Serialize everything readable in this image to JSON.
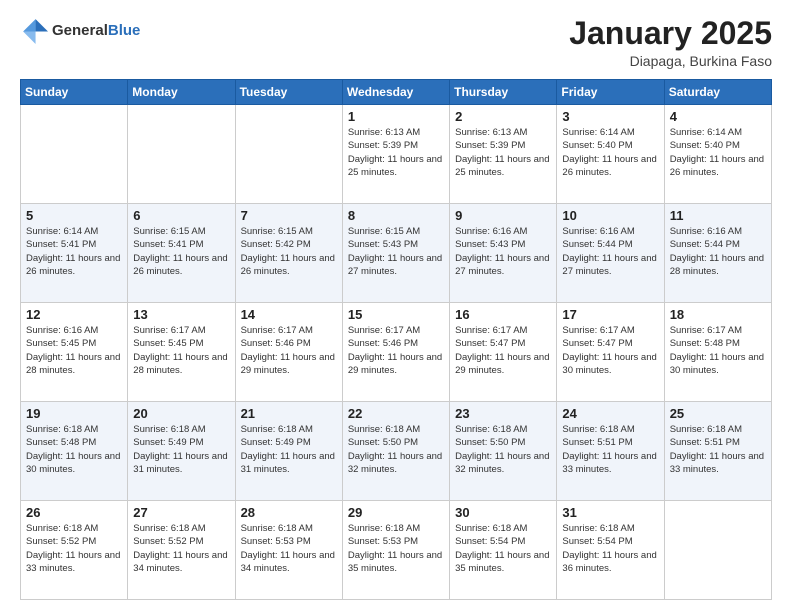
{
  "header": {
    "logo_general": "General",
    "logo_blue": "Blue",
    "month_title": "January 2025",
    "location": "Diapaga, Burkina Faso"
  },
  "weekdays": [
    "Sunday",
    "Monday",
    "Tuesday",
    "Wednesday",
    "Thursday",
    "Friday",
    "Saturday"
  ],
  "weeks": [
    [
      {
        "day": "",
        "info": ""
      },
      {
        "day": "",
        "info": ""
      },
      {
        "day": "",
        "info": ""
      },
      {
        "day": "1",
        "info": "Sunrise: 6:13 AM\nSunset: 5:39 PM\nDaylight: 11 hours and 25 minutes."
      },
      {
        "day": "2",
        "info": "Sunrise: 6:13 AM\nSunset: 5:39 PM\nDaylight: 11 hours and 25 minutes."
      },
      {
        "day": "3",
        "info": "Sunrise: 6:14 AM\nSunset: 5:40 PM\nDaylight: 11 hours and 26 minutes."
      },
      {
        "day": "4",
        "info": "Sunrise: 6:14 AM\nSunset: 5:40 PM\nDaylight: 11 hours and 26 minutes."
      }
    ],
    [
      {
        "day": "5",
        "info": "Sunrise: 6:14 AM\nSunset: 5:41 PM\nDaylight: 11 hours and 26 minutes."
      },
      {
        "day": "6",
        "info": "Sunrise: 6:15 AM\nSunset: 5:41 PM\nDaylight: 11 hours and 26 minutes."
      },
      {
        "day": "7",
        "info": "Sunrise: 6:15 AM\nSunset: 5:42 PM\nDaylight: 11 hours and 26 minutes."
      },
      {
        "day": "8",
        "info": "Sunrise: 6:15 AM\nSunset: 5:43 PM\nDaylight: 11 hours and 27 minutes."
      },
      {
        "day": "9",
        "info": "Sunrise: 6:16 AM\nSunset: 5:43 PM\nDaylight: 11 hours and 27 minutes."
      },
      {
        "day": "10",
        "info": "Sunrise: 6:16 AM\nSunset: 5:44 PM\nDaylight: 11 hours and 27 minutes."
      },
      {
        "day": "11",
        "info": "Sunrise: 6:16 AM\nSunset: 5:44 PM\nDaylight: 11 hours and 28 minutes."
      }
    ],
    [
      {
        "day": "12",
        "info": "Sunrise: 6:16 AM\nSunset: 5:45 PM\nDaylight: 11 hours and 28 minutes."
      },
      {
        "day": "13",
        "info": "Sunrise: 6:17 AM\nSunset: 5:45 PM\nDaylight: 11 hours and 28 minutes."
      },
      {
        "day": "14",
        "info": "Sunrise: 6:17 AM\nSunset: 5:46 PM\nDaylight: 11 hours and 29 minutes."
      },
      {
        "day": "15",
        "info": "Sunrise: 6:17 AM\nSunset: 5:46 PM\nDaylight: 11 hours and 29 minutes."
      },
      {
        "day": "16",
        "info": "Sunrise: 6:17 AM\nSunset: 5:47 PM\nDaylight: 11 hours and 29 minutes."
      },
      {
        "day": "17",
        "info": "Sunrise: 6:17 AM\nSunset: 5:47 PM\nDaylight: 11 hours and 30 minutes."
      },
      {
        "day": "18",
        "info": "Sunrise: 6:17 AM\nSunset: 5:48 PM\nDaylight: 11 hours and 30 minutes."
      }
    ],
    [
      {
        "day": "19",
        "info": "Sunrise: 6:18 AM\nSunset: 5:48 PM\nDaylight: 11 hours and 30 minutes."
      },
      {
        "day": "20",
        "info": "Sunrise: 6:18 AM\nSunset: 5:49 PM\nDaylight: 11 hours and 31 minutes."
      },
      {
        "day": "21",
        "info": "Sunrise: 6:18 AM\nSunset: 5:49 PM\nDaylight: 11 hours and 31 minutes."
      },
      {
        "day": "22",
        "info": "Sunrise: 6:18 AM\nSunset: 5:50 PM\nDaylight: 11 hours and 32 minutes."
      },
      {
        "day": "23",
        "info": "Sunrise: 6:18 AM\nSunset: 5:50 PM\nDaylight: 11 hours and 32 minutes."
      },
      {
        "day": "24",
        "info": "Sunrise: 6:18 AM\nSunset: 5:51 PM\nDaylight: 11 hours and 33 minutes."
      },
      {
        "day": "25",
        "info": "Sunrise: 6:18 AM\nSunset: 5:51 PM\nDaylight: 11 hours and 33 minutes."
      }
    ],
    [
      {
        "day": "26",
        "info": "Sunrise: 6:18 AM\nSunset: 5:52 PM\nDaylight: 11 hours and 33 minutes."
      },
      {
        "day": "27",
        "info": "Sunrise: 6:18 AM\nSunset: 5:52 PM\nDaylight: 11 hours and 34 minutes."
      },
      {
        "day": "28",
        "info": "Sunrise: 6:18 AM\nSunset: 5:53 PM\nDaylight: 11 hours and 34 minutes."
      },
      {
        "day": "29",
        "info": "Sunrise: 6:18 AM\nSunset: 5:53 PM\nDaylight: 11 hours and 35 minutes."
      },
      {
        "day": "30",
        "info": "Sunrise: 6:18 AM\nSunset: 5:54 PM\nDaylight: 11 hours and 35 minutes."
      },
      {
        "day": "31",
        "info": "Sunrise: 6:18 AM\nSunset: 5:54 PM\nDaylight: 11 hours and 36 minutes."
      },
      {
        "day": "",
        "info": ""
      }
    ]
  ]
}
